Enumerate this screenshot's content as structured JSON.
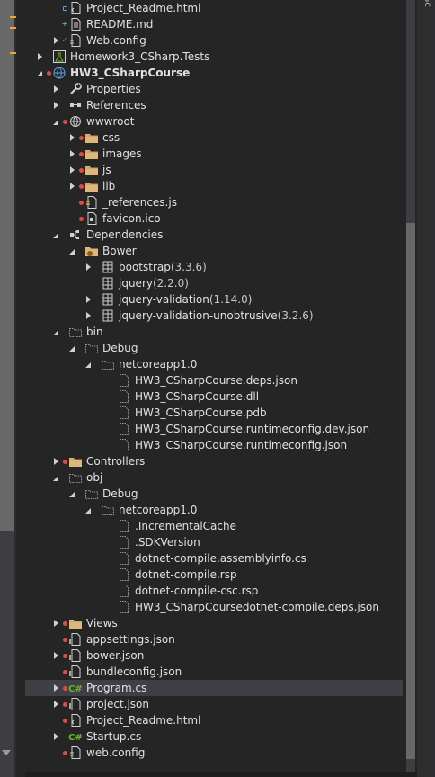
{
  "colors": {
    "background": "#252526",
    "text": "#e1e1e1",
    "folder": "#dcb67a",
    "csharp": "#68b723",
    "red_indicator": "#e24a48",
    "selected_row": "#3f3f46"
  },
  "right_panel": {
    "label": "Sc"
  },
  "tree": [
    {
      "indent": 1,
      "expander": "none",
      "overlay": "lock",
      "icon": "file-html-icon",
      "label": "Project_Readme.html",
      "suffix": ""
    },
    {
      "indent": 1,
      "expander": "none",
      "overlay": "plus",
      "icon": "file-md-icon",
      "label": "README.md",
      "suffix": ""
    },
    {
      "indent": 1,
      "expander": "closed",
      "overlay": "check",
      "icon": "config-file-icon",
      "label": "Web.config",
      "suffix": ""
    },
    {
      "indent": 0,
      "expander": "closed",
      "overlay": "none",
      "icon": "test-project-icon",
      "label": "Homework3_CSharp.Tests",
      "suffix": ""
    },
    {
      "indent": 0,
      "expander": "open",
      "overlay": "red",
      "icon": "web-project-icon",
      "label": "HW3_CSharpCourse",
      "suffix": "",
      "bold": true
    },
    {
      "indent": 1,
      "expander": "closed",
      "overlay": "none",
      "icon": "wrench-icon",
      "label": "Properties",
      "suffix": ""
    },
    {
      "indent": 1,
      "expander": "closed",
      "overlay": "none",
      "icon": "references-icon",
      "label": "References",
      "suffix": ""
    },
    {
      "indent": 1,
      "expander": "open",
      "overlay": "red",
      "icon": "globe-folder-icon",
      "label": "wwwroot",
      "suffix": ""
    },
    {
      "indent": 2,
      "expander": "closed",
      "overlay": "red",
      "icon": "folder-icon",
      "label": "css",
      "suffix": ""
    },
    {
      "indent": 2,
      "expander": "closed",
      "overlay": "red",
      "icon": "folder-icon",
      "label": "images",
      "suffix": ""
    },
    {
      "indent": 2,
      "expander": "closed",
      "overlay": "red",
      "icon": "folder-icon",
      "label": "js",
      "suffix": ""
    },
    {
      "indent": 2,
      "expander": "closed",
      "overlay": "red",
      "icon": "folder-icon",
      "label": "lib",
      "suffix": ""
    },
    {
      "indent": 2,
      "expander": "none",
      "overlay": "red",
      "icon": "js-file-icon",
      "label": "_references.js",
      "suffix": ""
    },
    {
      "indent": 2,
      "expander": "none",
      "overlay": "red",
      "icon": "favicon-icon",
      "label": "favicon.ico",
      "suffix": ""
    },
    {
      "indent": 1,
      "expander": "open",
      "overlay": "none",
      "icon": "dependencies-icon",
      "label": "Dependencies",
      "suffix": ""
    },
    {
      "indent": 2,
      "expander": "open",
      "overlay": "none",
      "icon": "bower-folder-icon",
      "label": "Bower",
      "suffix": ""
    },
    {
      "indent": 3,
      "expander": "closed",
      "overlay": "none",
      "icon": "package-icon",
      "label": "bootstrap",
      "suffix": " (3.3.6)"
    },
    {
      "indent": 3,
      "expander": "none",
      "overlay": "none",
      "icon": "package-icon",
      "label": "jquery",
      "suffix": " (2.2.0)"
    },
    {
      "indent": 3,
      "expander": "closed",
      "overlay": "none",
      "icon": "package-icon",
      "label": "jquery-validation",
      "suffix": " (1.14.0)"
    },
    {
      "indent": 3,
      "expander": "closed",
      "overlay": "none",
      "icon": "package-icon",
      "label": "jquery-validation-unobtrusive",
      "suffix": " (3.2.6)"
    },
    {
      "indent": 1,
      "expander": "open",
      "overlay": "none",
      "icon": "hidden-folder-icon",
      "label": "bin",
      "suffix": ""
    },
    {
      "indent": 2,
      "expander": "open",
      "overlay": "none",
      "icon": "hidden-folder-icon",
      "label": "Debug",
      "suffix": ""
    },
    {
      "indent": 3,
      "expander": "open",
      "overlay": "none",
      "icon": "hidden-folder-icon",
      "label": "netcoreapp1.0",
      "suffix": ""
    },
    {
      "indent": 4,
      "expander": "none",
      "overlay": "none",
      "icon": "hidden-file-icon",
      "label": "HW3_CSharpCourse.deps.json",
      "suffix": ""
    },
    {
      "indent": 4,
      "expander": "none",
      "overlay": "none",
      "icon": "hidden-file-icon",
      "label": "HW3_CSharpCourse.dll",
      "suffix": ""
    },
    {
      "indent": 4,
      "expander": "none",
      "overlay": "none",
      "icon": "hidden-file-icon",
      "label": "HW3_CSharpCourse.pdb",
      "suffix": ""
    },
    {
      "indent": 4,
      "expander": "none",
      "overlay": "none",
      "icon": "hidden-file-icon",
      "label": "HW3_CSharpCourse.runtimeconfig.dev.json",
      "suffix": ""
    },
    {
      "indent": 4,
      "expander": "none",
      "overlay": "none",
      "icon": "hidden-file-icon",
      "label": "HW3_CSharpCourse.runtimeconfig.json",
      "suffix": ""
    },
    {
      "indent": 1,
      "expander": "closed",
      "overlay": "red",
      "icon": "folder-icon",
      "label": "Controllers",
      "suffix": ""
    },
    {
      "indent": 1,
      "expander": "open",
      "overlay": "none",
      "icon": "hidden-folder-icon",
      "label": "obj",
      "suffix": ""
    },
    {
      "indent": 2,
      "expander": "open",
      "overlay": "none",
      "icon": "hidden-folder-icon",
      "label": "Debug",
      "suffix": ""
    },
    {
      "indent": 3,
      "expander": "open",
      "overlay": "none",
      "icon": "hidden-folder-icon",
      "label": "netcoreapp1.0",
      "suffix": ""
    },
    {
      "indent": 4,
      "expander": "none",
      "overlay": "none",
      "icon": "hidden-file-icon",
      "label": ".IncrementalCache",
      "suffix": ""
    },
    {
      "indent": 4,
      "expander": "none",
      "overlay": "none",
      "icon": "hidden-file-icon",
      "label": ".SDKVersion",
      "suffix": ""
    },
    {
      "indent": 4,
      "expander": "none",
      "overlay": "none",
      "icon": "hidden-file-icon",
      "label": "dotnet-compile.assemblyinfo.cs",
      "suffix": ""
    },
    {
      "indent": 4,
      "expander": "none",
      "overlay": "none",
      "icon": "hidden-file-icon",
      "label": "dotnet-compile.rsp",
      "suffix": ""
    },
    {
      "indent": 4,
      "expander": "none",
      "overlay": "none",
      "icon": "hidden-file-icon",
      "label": "dotnet-compile-csc.rsp",
      "suffix": ""
    },
    {
      "indent": 4,
      "expander": "none",
      "overlay": "none",
      "icon": "hidden-file-icon",
      "label": "HW3_CSharpCoursedotnet-compile.deps.json",
      "suffix": ""
    },
    {
      "indent": 1,
      "expander": "closed",
      "overlay": "red",
      "icon": "folder-icon",
      "label": "Views",
      "suffix": ""
    },
    {
      "indent": 1,
      "expander": "none",
      "overlay": "red",
      "icon": "json-file-icon",
      "label": "appsettings.json",
      "suffix": ""
    },
    {
      "indent": 1,
      "expander": "closed",
      "overlay": "red",
      "icon": "json-file-icon",
      "label": "bower.json",
      "suffix": ""
    },
    {
      "indent": 1,
      "expander": "none",
      "overlay": "red",
      "icon": "json-file-icon",
      "label": "bundleconfig.json",
      "suffix": ""
    },
    {
      "indent": 1,
      "expander": "closed",
      "overlay": "red",
      "icon": "csharp-file-icon",
      "label": "Program.cs",
      "suffix": "",
      "selected": true
    },
    {
      "indent": 1,
      "expander": "closed",
      "overlay": "red",
      "icon": "json-file-icon",
      "label": "project.json",
      "suffix": ""
    },
    {
      "indent": 1,
      "expander": "none",
      "overlay": "red",
      "icon": "file-html-icon",
      "label": "Project_Readme.html",
      "suffix": ""
    },
    {
      "indent": 1,
      "expander": "closed",
      "overlay": "none",
      "icon": "csharp-file-icon",
      "label": "Startup.cs",
      "suffix": ""
    },
    {
      "indent": 1,
      "expander": "none",
      "overlay": "red",
      "icon": "config-file-icon",
      "label": "web.config",
      "suffix": ""
    }
  ]
}
